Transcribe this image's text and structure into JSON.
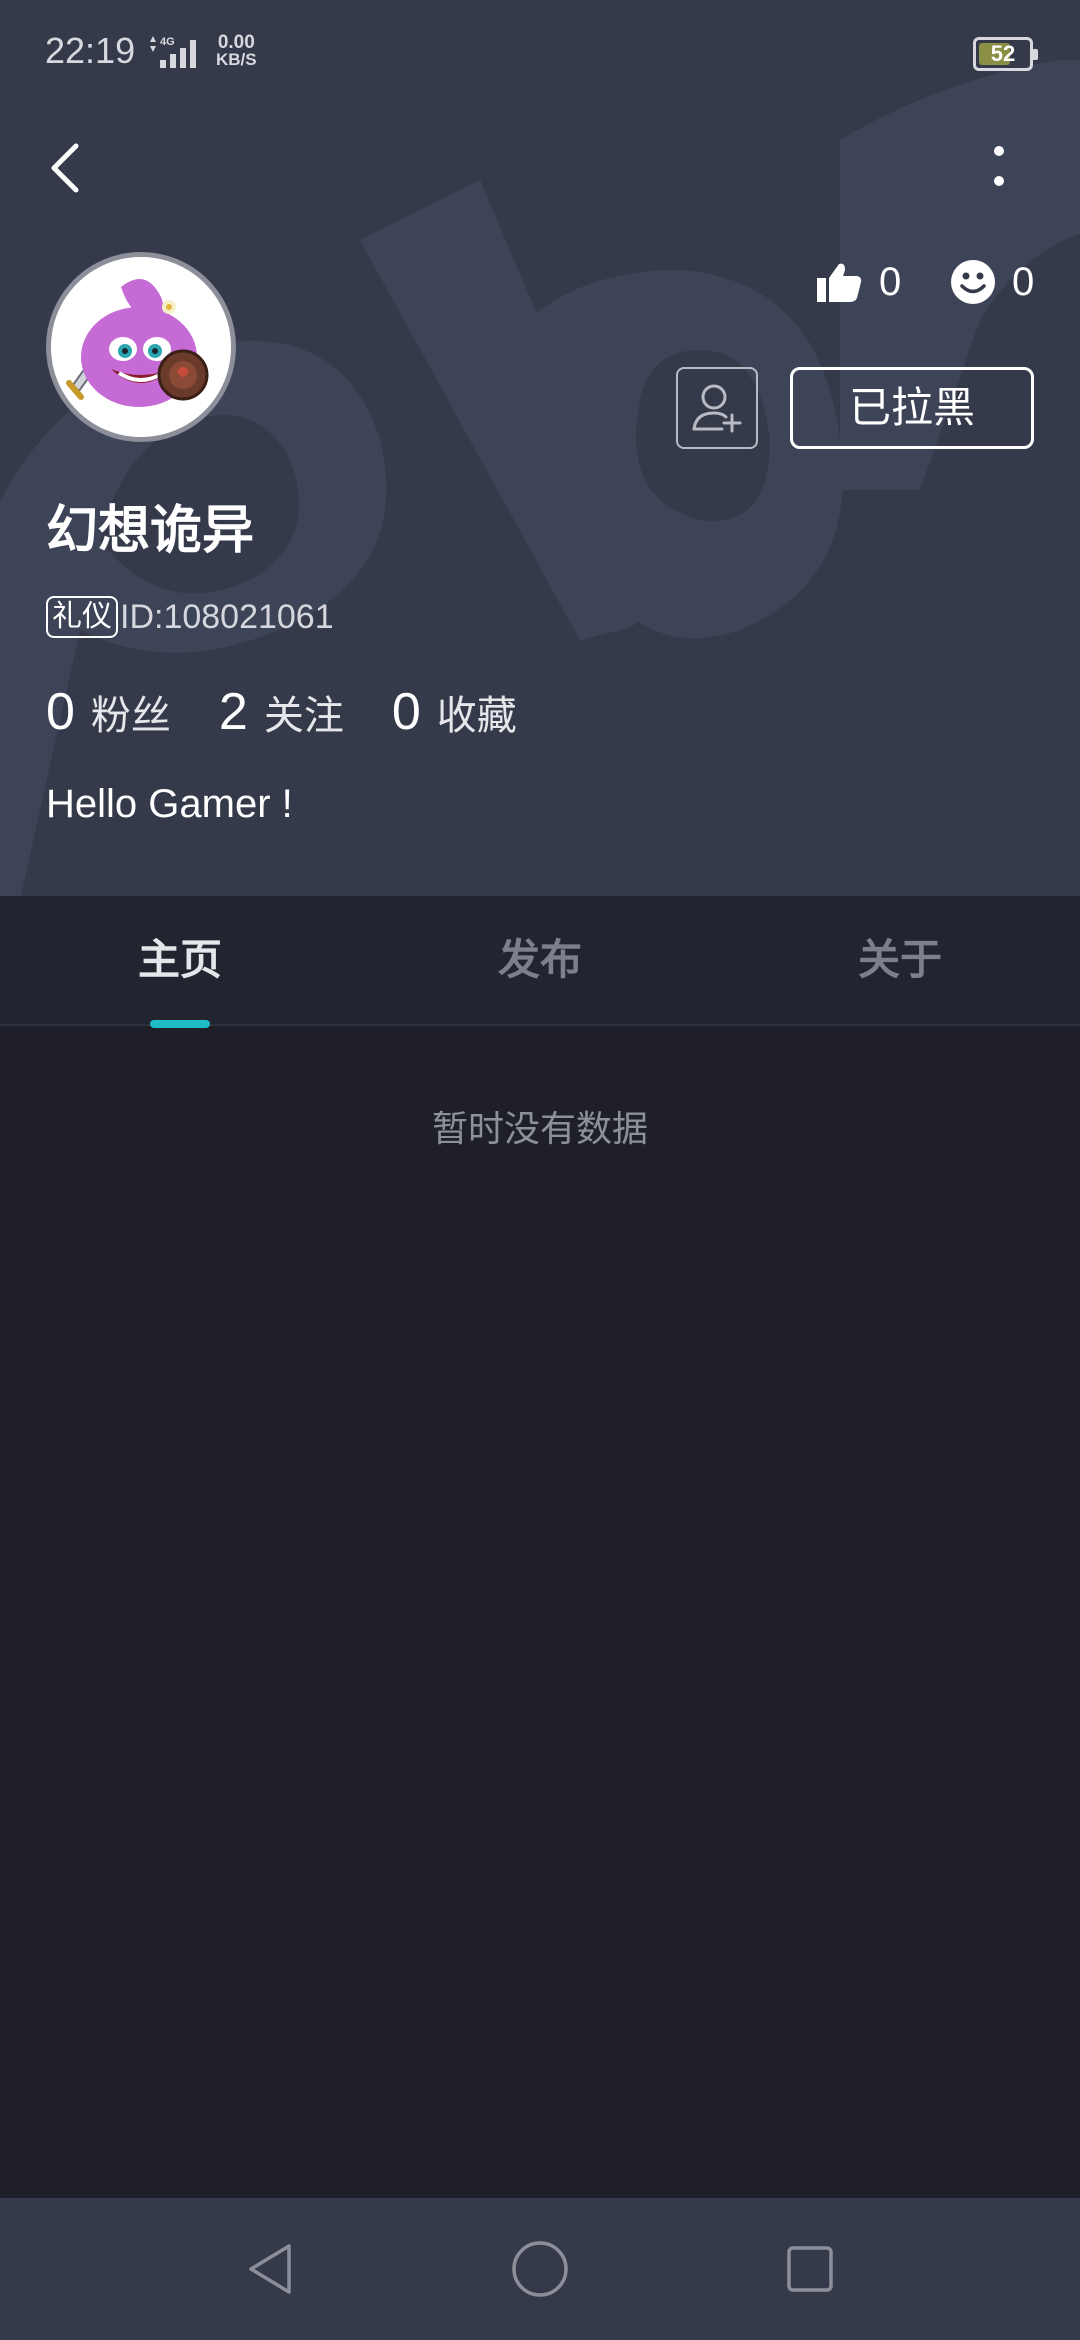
{
  "status_bar": {
    "time": "22:19",
    "network": "4G",
    "speed_value": "0.00",
    "speed_unit": "KB/S",
    "battery": "52"
  },
  "profile": {
    "username": "幻想诡异",
    "badge": "礼仪",
    "id_text": "ID:108021061",
    "likes": "0",
    "smiles": "0",
    "block_button": "已拉黑",
    "bio": "Hello Gamer !",
    "counts": [
      {
        "value": "0",
        "label": "粉丝"
      },
      {
        "value": "2",
        "label": "关注"
      },
      {
        "value": "0",
        "label": "收藏"
      }
    ]
  },
  "tabs": [
    {
      "label": "主页",
      "active": true
    },
    {
      "label": "发布",
      "active": false
    },
    {
      "label": "关于",
      "active": false
    }
  ],
  "content": {
    "empty_text": "暂时没有数据"
  },
  "colors": {
    "header_bg": "#353a4a",
    "page_bg": "#1f1f29",
    "accent": "#1fbcc4"
  },
  "icons": {
    "back": "back-arrow-icon",
    "more": "more-vertical-icon",
    "like": "thumbs-up-icon",
    "smile": "smile-icon",
    "add_friend": "add-user-icon",
    "nav_back": "triangle-back-icon",
    "nav_home": "circle-home-icon",
    "nav_recent": "square-recent-icon"
  }
}
